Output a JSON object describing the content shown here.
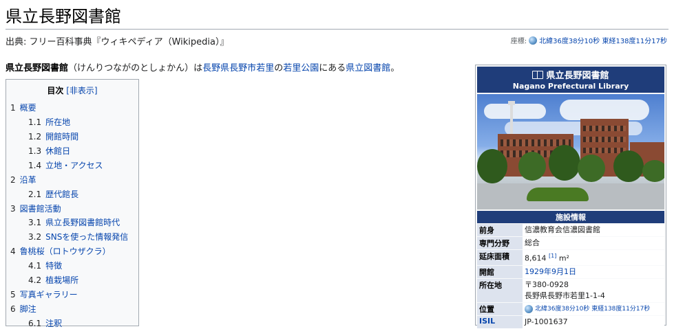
{
  "page": {
    "title": "県立長野図書館",
    "from": "出典: フリー百科事典『ウィキペディア（Wikipedia）』",
    "coords_label": "座標:",
    "coords_text": "北緯36度38分10秒 東経138度11分17秒"
  },
  "lead": {
    "bold": "県立長野図書館",
    "reading": "（けんりつながのとしょかん）は",
    "link1": "長野県",
    "link2": "長野市",
    "link3": "若里",
    "mid1": "の",
    "link4": "若里公園",
    "mid2": "にある",
    "link5": "県立図書館",
    "end": "。"
  },
  "toc": {
    "title": "目次",
    "toggle": "[非表示]",
    "items": [
      {
        "num": "1",
        "text": "概要"
      },
      {
        "num": "1.1",
        "text": "所在地"
      },
      {
        "num": "1.2",
        "text": "開館時間"
      },
      {
        "num": "1.3",
        "text": "休館日"
      },
      {
        "num": "1.4",
        "text": "立地・アクセス"
      },
      {
        "num": "2",
        "text": "沿革"
      },
      {
        "num": "2.1",
        "text": "歴代館長"
      },
      {
        "num": "3",
        "text": "図書館活動"
      },
      {
        "num": "3.1",
        "text": "県立長野図書館時代"
      },
      {
        "num": "3.2",
        "text": "SNSを使った情報発信"
      },
      {
        "num": "4",
        "text": "鲁桃桜（ロトウザクラ）"
      },
      {
        "num": "4.1",
        "text": "特徴"
      },
      {
        "num": "4.2",
        "text": "植栽場所"
      },
      {
        "num": "5",
        "text": "写真ギャラリー"
      },
      {
        "num": "6",
        "text": "脚注"
      },
      {
        "num": "6.1",
        "text": "注釈"
      }
    ]
  },
  "infobox": {
    "title_jp": "県立長野図書館",
    "title_en": "Nagano Prefectural Library",
    "section": "施設情報",
    "rows": {
      "predecessor": {
        "label": "前身",
        "value": "信濃教育会信濃図書館"
      },
      "field": {
        "label": "専門分野",
        "value": "総合"
      },
      "area": {
        "label": "延床面積",
        "value": "8,614",
        "ref": "[1]",
        "unit": "m²"
      },
      "opened": {
        "label": "開館",
        "value": "1929年9月1日"
      },
      "address": {
        "label": "所在地",
        "postal": "〒380-0928",
        "value": "長野県長野市若里1-1-4"
      },
      "location": {
        "label": "位置",
        "value": "北緯36度38分10秒 東経138度11分17秒"
      },
      "isil": {
        "label": "ISIL",
        "value": "JP-1001637"
      }
    }
  },
  "colors": {
    "link": "#0645ad",
    "infobox_header": "#1f3d7a",
    "border": "#a2a9b1"
  }
}
